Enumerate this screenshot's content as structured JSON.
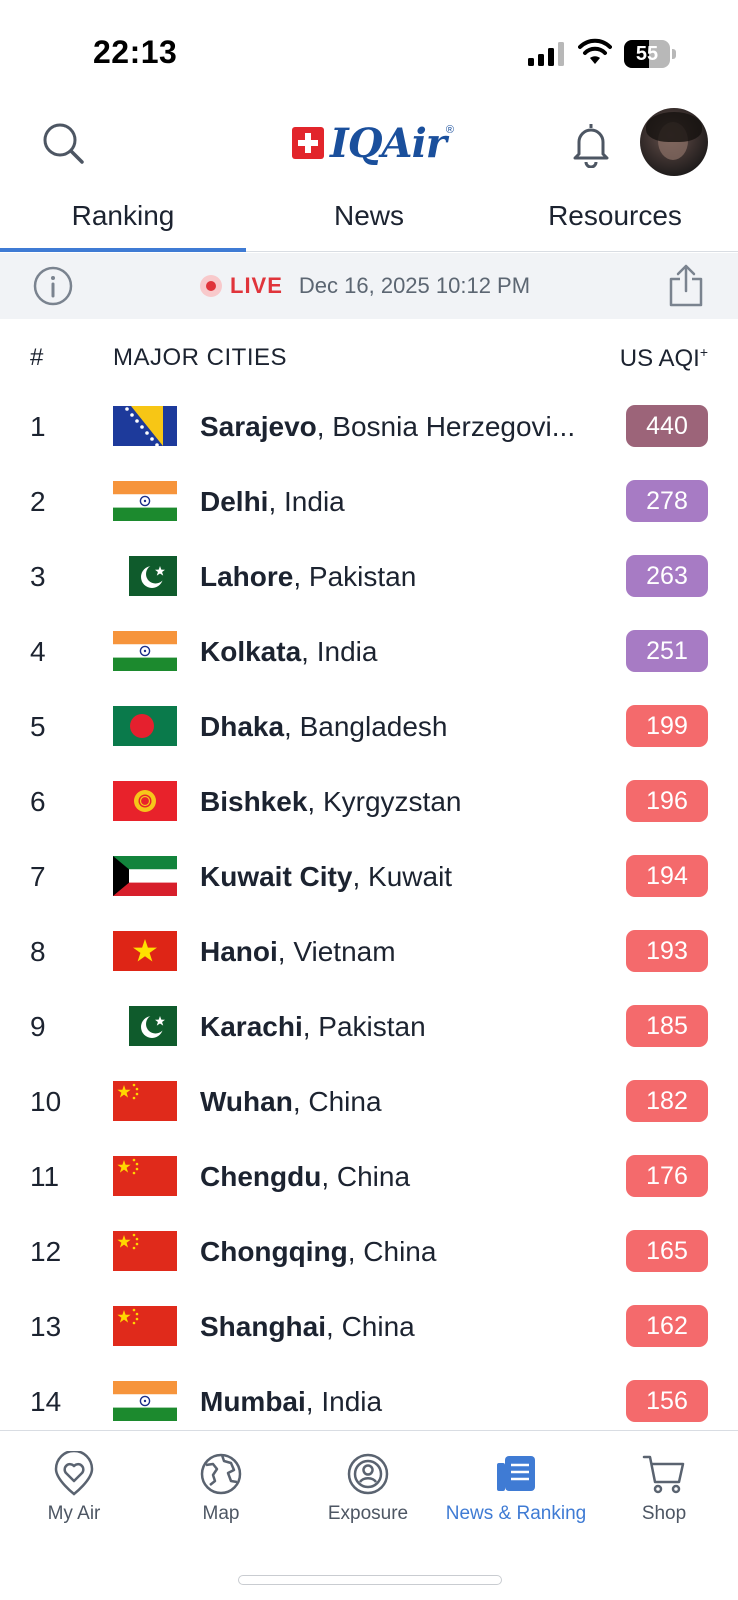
{
  "status_bar": {
    "time": "22:13",
    "battery": "55",
    "battery_level": 0.55
  },
  "header": {
    "logo_text": "IQAir",
    "logo_mark": "®",
    "search_icon": "search-icon",
    "bell_icon": "bell-icon"
  },
  "tabs": [
    {
      "label": "Ranking",
      "active": true
    },
    {
      "label": "News",
      "active": false
    },
    {
      "label": "Resources",
      "active": false
    }
  ],
  "live_bar": {
    "live_label": "LIVE",
    "datetime": "Dec 16, 2025 10:12 PM"
  },
  "list_header": {
    "rank": "#",
    "city": "MAJOR CITIES",
    "aqi": "US AQI",
    "aqi_sup": "+"
  },
  "colors": {
    "accent": "#3f7bd4",
    "hazardous": "#9c6479",
    "very_unhealthy": "#a77bc4",
    "unhealthy": "#f46a6c",
    "live": "#e0343b"
  },
  "rankings": [
    {
      "rank": "1",
      "city": "Sarajevo",
      "country": ", Bosnia Herzegovi...",
      "aqi": "440",
      "flag": "bosnia",
      "level": "hazardous"
    },
    {
      "rank": "2",
      "city": "Delhi",
      "country": ", India",
      "aqi": "278",
      "flag": "india",
      "level": "very_unhealthy"
    },
    {
      "rank": "3",
      "city": "Lahore",
      "country": ", Pakistan",
      "aqi": "263",
      "flag": "pakistan",
      "level": "very_unhealthy"
    },
    {
      "rank": "4",
      "city": "Kolkata",
      "country": ", India",
      "aqi": "251",
      "flag": "india",
      "level": "very_unhealthy"
    },
    {
      "rank": "5",
      "city": "Dhaka",
      "country": ", Bangladesh",
      "aqi": "199",
      "flag": "bangladesh",
      "level": "unhealthy"
    },
    {
      "rank": "6",
      "city": "Bishkek",
      "country": ", Kyrgyzstan",
      "aqi": "196",
      "flag": "kyrgyzstan",
      "level": "unhealthy"
    },
    {
      "rank": "7",
      "city": "Kuwait City",
      "country": ", Kuwait",
      "aqi": "194",
      "flag": "kuwait",
      "level": "unhealthy"
    },
    {
      "rank": "8",
      "city": "Hanoi",
      "country": ", Vietnam",
      "aqi": "193",
      "flag": "vietnam",
      "level": "unhealthy"
    },
    {
      "rank": "9",
      "city": "Karachi",
      "country": ", Pakistan",
      "aqi": "185",
      "flag": "pakistan",
      "level": "unhealthy"
    },
    {
      "rank": "10",
      "city": "Wuhan",
      "country": ", China",
      "aqi": "182",
      "flag": "china",
      "level": "unhealthy"
    },
    {
      "rank": "11",
      "city": "Chengdu",
      "country": ", China",
      "aqi": "176",
      "flag": "china",
      "level": "unhealthy"
    },
    {
      "rank": "12",
      "city": "Chongqing",
      "country": ", China",
      "aqi": "165",
      "flag": "china",
      "level": "unhealthy"
    },
    {
      "rank": "13",
      "city": "Shanghai",
      "country": ", China",
      "aqi": "162",
      "flag": "china",
      "level": "unhealthy"
    },
    {
      "rank": "14",
      "city": "Mumbai",
      "country": ", India",
      "aqi": "156",
      "flag": "india",
      "level": "unhealthy"
    }
  ],
  "bottom_nav": [
    {
      "label": "My Air",
      "icon": "heart-pin-icon",
      "active": false
    },
    {
      "label": "Map",
      "icon": "globe-icon",
      "active": false
    },
    {
      "label": "Exposure",
      "icon": "exposure-icon",
      "active": false
    },
    {
      "label": "News & Ranking",
      "icon": "news-icon",
      "active": true
    },
    {
      "label": "Shop",
      "icon": "cart-icon",
      "active": false
    }
  ]
}
